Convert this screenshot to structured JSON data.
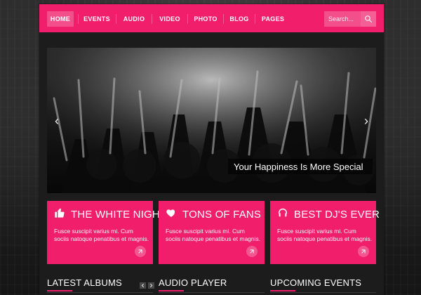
{
  "nav": {
    "items": [
      {
        "label": "HOME",
        "active": true
      },
      {
        "label": "EVENTS",
        "active": false
      },
      {
        "label": "AUDIO",
        "active": false
      },
      {
        "label": "VIDEO",
        "active": false
      },
      {
        "label": "PHOTO",
        "active": false
      },
      {
        "label": "BLOG",
        "active": false
      },
      {
        "label": "PAGES",
        "active": false
      }
    ],
    "search_placeholder": "Search...",
    "search_icon": "search-icon"
  },
  "hero": {
    "caption": "Your Happiness Is More Special",
    "left_arrow": "‹",
    "right_arrow": "›"
  },
  "features": [
    {
      "title": "THE WHITE NIGHT",
      "text": "Fusce suscipit varius mi. Cum sociis natoque penatibus et magnis.",
      "icon": "thumbs-up-icon"
    },
    {
      "title": "TONS OF FANS",
      "text": "Fusce suscipit varius mi. Cum sociis natoque penatibus et magnis.",
      "icon": "heart-icon"
    },
    {
      "title": "BEST DJ'S EVER",
      "text": "Fusce suscipit varius mi. Cum sociis natoque penatibus et magnis.",
      "icon": "headphones-icon"
    }
  ],
  "sections": {
    "latest_albums": "LATEST ALBUMS",
    "audio_player": "AUDIO PLAYER",
    "upcoming_events": "UPCOMING EVENTS"
  },
  "colors": {
    "accent": "#f01e6b"
  }
}
